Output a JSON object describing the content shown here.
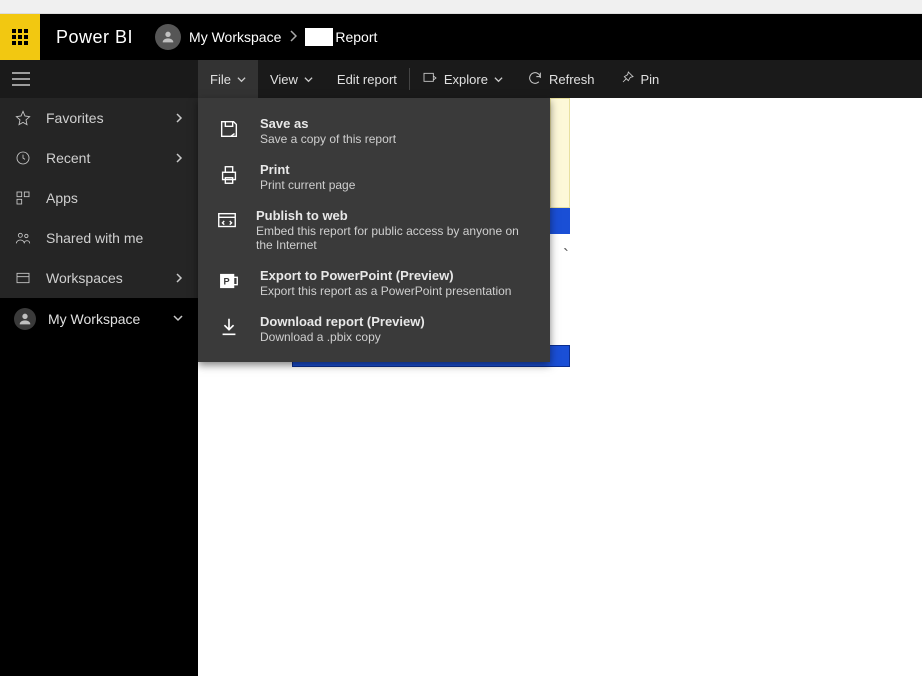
{
  "header": {
    "brand": "Power BI",
    "breadcrumb_workspace": "My Workspace",
    "breadcrumb_report": "Report"
  },
  "sidebar": {
    "favorites": "Favorites",
    "recent": "Recent",
    "apps": "Apps",
    "shared": "Shared with me",
    "workspaces": "Workspaces",
    "my_workspace": "My Workspace"
  },
  "toolbar": {
    "file": "File",
    "view": "View",
    "edit": "Edit report",
    "explore": "Explore",
    "refresh": "Refresh",
    "pin": "Pin"
  },
  "file_menu": {
    "items": [
      {
        "title": "Save as",
        "sub": "Save a copy of this report"
      },
      {
        "title": "Print",
        "sub": "Print current page"
      },
      {
        "title": "Publish to web",
        "sub": "Embed this report for public access by anyone on the Internet"
      },
      {
        "title": "Export to PowerPoint (Preview)",
        "sub": "Export this report as a PowerPoint presentation"
      },
      {
        "title": "Download report (Preview)",
        "sub": "Download a .pbix copy"
      }
    ]
  }
}
